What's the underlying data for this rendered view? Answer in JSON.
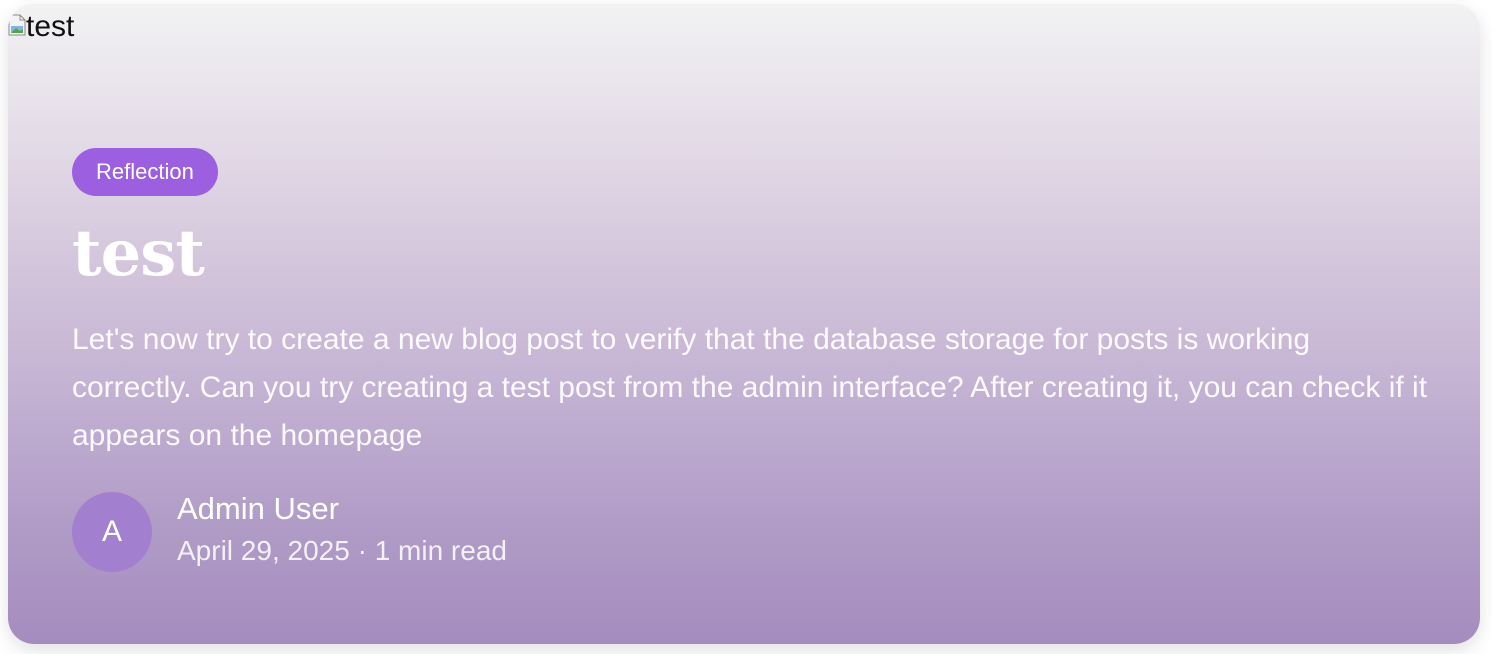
{
  "cover_image": {
    "alt_text": "test"
  },
  "post": {
    "category": "Reflection",
    "title": "test",
    "excerpt": "Let's now try to create a new blog post to verify that the database storage for posts is working correctly. Can you try creating a test post from the admin interface? After creating it, you can check if it appears on the homepage",
    "author": {
      "initial": "A",
      "name": "Admin User"
    },
    "date": "April 29, 2025",
    "separator": "·",
    "read_time": "1 min read"
  },
  "colors": {
    "badge": "#9b5fe0",
    "avatar": "#a27fcf",
    "gradient_top": "#f2f2f3",
    "gradient_bottom": "#a58cbf"
  }
}
